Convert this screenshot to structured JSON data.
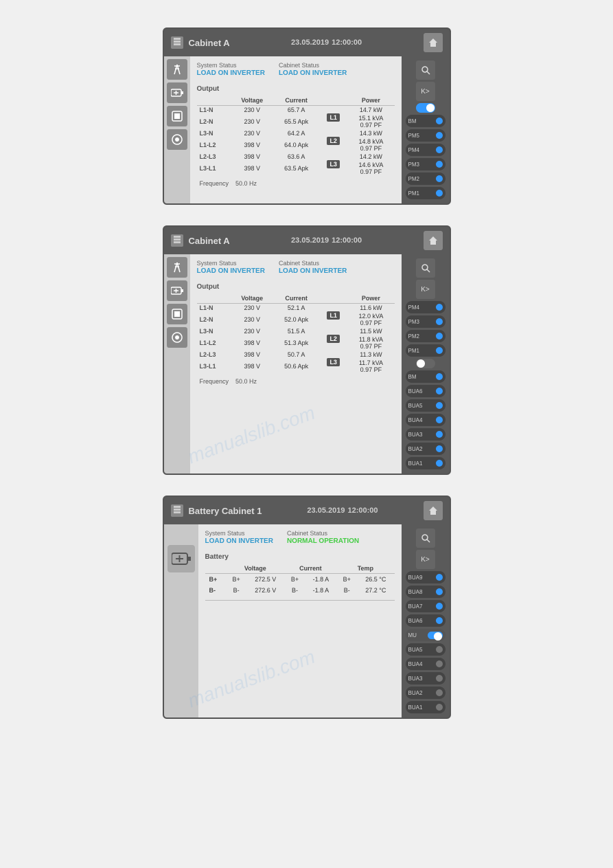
{
  "panels": [
    {
      "id": "panel1",
      "title": "Cabinet A",
      "date": "23.05.2019",
      "time": "12:00:00",
      "system_status_label": "System Status",
      "system_status": "LOAD ON INVERTER",
      "cabinet_status_label": "Cabinet Status",
      "cabinet_status": "LOAD ON INVERTER",
      "output_label": "Output",
      "table_headers": [
        "Voltage",
        "Current",
        "Power"
      ],
      "phases": [
        {
          "label": "L1",
          "rows": [
            {
              "name": "L1-N",
              "voltage": "230 V",
              "current": "65.7 A",
              "power": "14.7 kW"
            },
            {
              "name": "L2-N",
              "voltage": "230 V",
              "current": "65.5 Apk",
              "power": "15.1 kVA\n0.97 PF"
            }
          ]
        },
        {
          "label": "L2",
          "rows": [
            {
              "name": "L3-N",
              "voltage": "230 V",
              "current": "64.2 A",
              "power": "14.3 kW"
            },
            {
              "name": "L1-L2",
              "voltage": "398 V",
              "current": "64.0 Apk",
              "power": "14.8 kVA\n0.97 PF"
            }
          ]
        },
        {
          "label": "L3",
          "rows": [
            {
              "name": "L2-L3",
              "voltage": "398 V",
              "current": "63.6 A",
              "power": "14.2 kW"
            },
            {
              "name": "L3-L1",
              "voltage": "398 V",
              "current": "63.5 Apk",
              "power": "14.6 kVA\n0.97 PF"
            }
          ]
        }
      ],
      "frequency_label": "Frequency",
      "frequency_value": "50.0 Hz",
      "right_indicators": [
        {
          "label": "BM",
          "dot": "blue"
        },
        {
          "label": "PM5",
          "dot": "blue"
        },
        {
          "label": "PM4",
          "dot": "blue"
        },
        {
          "label": "PM3",
          "dot": "blue"
        },
        {
          "label": "PM2",
          "dot": "blue"
        },
        {
          "label": "PM1",
          "dot": "blue"
        }
      ],
      "has_toggle": true,
      "toggle_on": true,
      "icon_buttons": [
        "tower-icon",
        "battery-icon",
        "module-icon",
        "settings-icon"
      ]
    },
    {
      "id": "panel2",
      "title": "Cabinet A",
      "date": "23.05.2019",
      "time": "12:00:00",
      "system_status_label": "System Status",
      "system_status": "LOAD ON INVERTER",
      "cabinet_status_label": "Cabinet Status",
      "cabinet_status": "LOAD ON INVERTER",
      "output_label": "Output",
      "table_headers": [
        "Voltage",
        "Current",
        "Power"
      ],
      "phases": [
        {
          "label": "L1",
          "rows": [
            {
              "name": "L1-N",
              "voltage": "230 V",
              "current": "52.1 A",
              "power": "11.6 kW"
            },
            {
              "name": "L2-N",
              "voltage": "230 V",
              "current": "52.0 Apk",
              "power": "12.0 kVA\n0.97 PF"
            }
          ]
        },
        {
          "label": "L2",
          "rows": [
            {
              "name": "L3-N",
              "voltage": "230 V",
              "current": "51.5 A",
              "power": "11.5 kW"
            },
            {
              "name": "L1-L2",
              "voltage": "398 V",
              "current": "51.3 Apk",
              "power": "11.8 kVA\n0.97 PF"
            }
          ]
        },
        {
          "label": "L3",
          "rows": [
            {
              "name": "L2-L3",
              "voltage": "398 V",
              "current": "50.7 A",
              "power": "11.3 kW"
            },
            {
              "name": "L3-L1",
              "voltage": "398 V",
              "current": "50.6 Apk",
              "power": "11.7 kVA\n0.97 PF"
            }
          ]
        }
      ],
      "frequency_label": "Frequency",
      "frequency_value": "50.0 Hz",
      "right_indicators": [
        {
          "label": "PM4",
          "dot": "blue"
        },
        {
          "label": "PM3",
          "dot": "blue"
        },
        {
          "label": "PM2",
          "dot": "blue"
        },
        {
          "label": "PM1",
          "dot": "blue"
        },
        {
          "label": "BM",
          "dot": "blue"
        },
        {
          "label": "BUA6",
          "dot": "blue"
        },
        {
          "label": "BUA5",
          "dot": "blue"
        },
        {
          "label": "BUA4",
          "dot": "blue"
        },
        {
          "label": "BUA3",
          "dot": "blue"
        },
        {
          "label": "BUA2",
          "dot": "blue"
        },
        {
          "label": "BUA1",
          "dot": "blue"
        }
      ],
      "has_toggle": false,
      "icon_buttons": [
        "tower-icon",
        "battery-icon",
        "module-icon",
        "settings-icon"
      ]
    },
    {
      "id": "panel3",
      "title": "Battery Cabinet 1",
      "date": "23.05.2019",
      "time": "12:00:00",
      "system_status_label": "System Status",
      "system_status": "LOAD ON INVERTER",
      "cabinet_status_label": "Cabinet Status",
      "cabinet_status": "NORMAL OPERATION",
      "cabinet_status_color": "#44cc44",
      "battery_label": "Battery",
      "battery_headers": [
        "Voltage",
        "Current",
        "Temp"
      ],
      "battery_rows": [
        {
          "label": "B+",
          "voltage_label": "B+",
          "voltage": "272.5 V",
          "current_label": "B+",
          "current": "-1.8 A",
          "temp_label": "B+",
          "temp": "26.5 °C"
        },
        {
          "label": "B-",
          "voltage_label": "B-",
          "voltage": "272.6 V",
          "current_label": "B-",
          "current": "-1.8 A",
          "temp_label": "B-",
          "temp": "27.2 °C"
        }
      ],
      "right_indicators": [
        {
          "label": "BUA9",
          "dot": "blue"
        },
        {
          "label": "BUA8",
          "dot": "blue"
        },
        {
          "label": "BUA7",
          "dot": "blue"
        },
        {
          "label": "BUA6",
          "dot": "blue"
        },
        {
          "label": "MU",
          "dot": "orange",
          "has_toggle": true
        },
        {
          "label": "BUA5",
          "dot": "gray"
        },
        {
          "label": "BUA4",
          "dot": "gray"
        },
        {
          "label": "BUA3",
          "dot": "gray"
        },
        {
          "label": "BUA2",
          "dot": "gray"
        },
        {
          "label": "BUA1",
          "dot": "gray"
        }
      ]
    }
  ]
}
